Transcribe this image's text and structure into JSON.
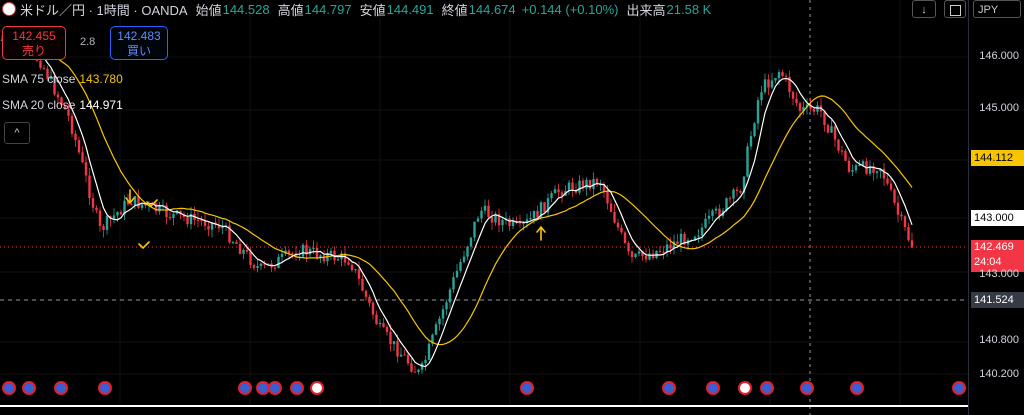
{
  "header": {
    "symbol": "米ドル／円 · 1時間 · OANDA",
    "open_label": "始値",
    "open_value": "144.528",
    "high_label": "高値",
    "high_value": "144.797",
    "low_label": "安値",
    "low_value": "144.491",
    "close_label": "終値",
    "close_value": "144.674",
    "change": "+0.144 (+0.10%)",
    "volume_label": "出来高",
    "volume_value": "21.58 K"
  },
  "trade": {
    "sell_price": "142.455",
    "sell_label": "売り",
    "spread": "2.8",
    "buy_price": "142.483",
    "buy_label": "買い"
  },
  "indicators": [
    {
      "label": "SMA 75 close",
      "value": "143.780",
      "color": "#f7c600"
    },
    {
      "label": "SMA 20 close",
      "value": "144.971",
      "color": "#ffffff"
    }
  ],
  "currency": "JPY",
  "collapse_glyph": "^",
  "download_glyph": "↓",
  "y_axis": {
    "ticks": [
      "146.000",
      "145.000",
      "143.000",
      "142.000",
      "140.800",
      "140.200"
    ],
    "tags": {
      "sma75": "144.112",
      "sma20": "143.000",
      "last_price": "142.469",
      "countdown": "24:04",
      "crosshair": "141.524"
    }
  },
  "colors": {
    "up": "#26a69a",
    "down": "#f23645",
    "sma75": "#f7c600",
    "sma20": "#ffffff"
  }
}
